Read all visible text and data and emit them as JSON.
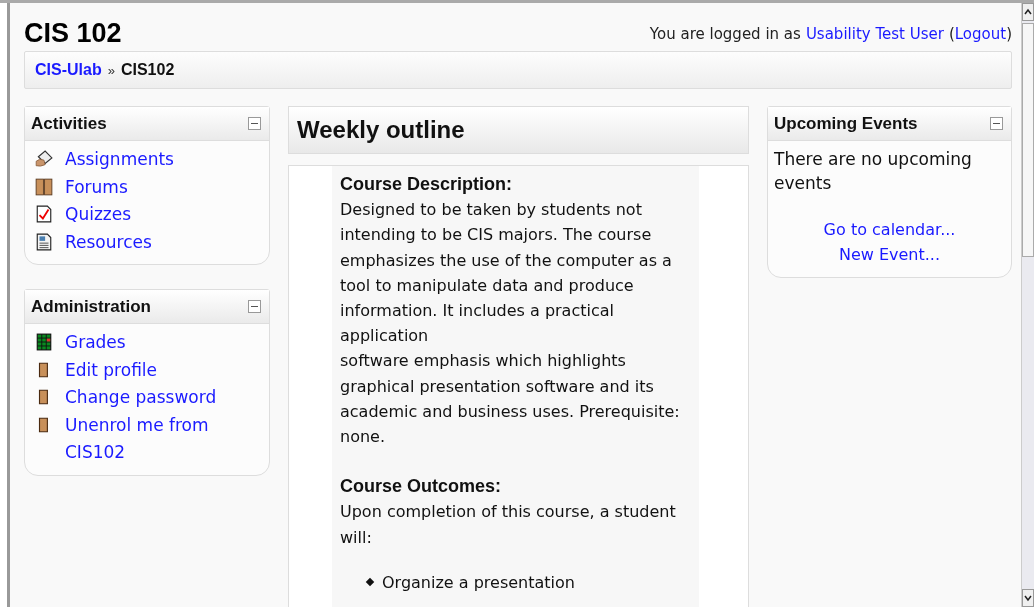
{
  "header": {
    "title": "CIS 102",
    "login_prefix": "You are logged in as",
    "user": "Usability Test User",
    "logout_open": "(",
    "logout": "Logout",
    "logout_close": ")"
  },
  "breadcrumb": {
    "items": [
      "CIS-Ulab",
      "CIS102"
    ],
    "separator": "»"
  },
  "blocks_left": [
    {
      "title": "Activities",
      "items": [
        {
          "kind": "assignment",
          "label": "Assignments"
        },
        {
          "kind": "forum",
          "label": "Forums"
        },
        {
          "kind": "quiz",
          "label": "Quizzes"
        },
        {
          "kind": "resource",
          "label": "Resources"
        }
      ]
    },
    {
      "title": "Administration",
      "items": [
        {
          "kind": "grades",
          "label": "Grades"
        },
        {
          "kind": "user",
          "label": "Edit profile"
        },
        {
          "kind": "user",
          "label": "Change password"
        },
        {
          "kind": "user",
          "label": "Unenrol me from CIS102"
        }
      ]
    }
  ],
  "main": {
    "title": "Weekly outline",
    "sections": [
      {
        "heading": "Course Description:",
        "text": "Designed to be taken by students not intending to be CIS majors. The course emphasizes the use of the computer as a tool to manipulate data and produce information. It includes a practical application\nsoftware emphasis which highlights graphical presentation software and its academic and business uses. Prerequisite: none."
      },
      {
        "heading": "Course Outcomes:",
        "text": "Upon completion of this course, a student will:",
        "bullets": [
          "Organize a presentation"
        ]
      }
    ]
  },
  "events": {
    "title": "Upcoming Events",
    "text": "There are no upcoming events",
    "links": [
      "Go to calendar...",
      "New Event..."
    ]
  }
}
